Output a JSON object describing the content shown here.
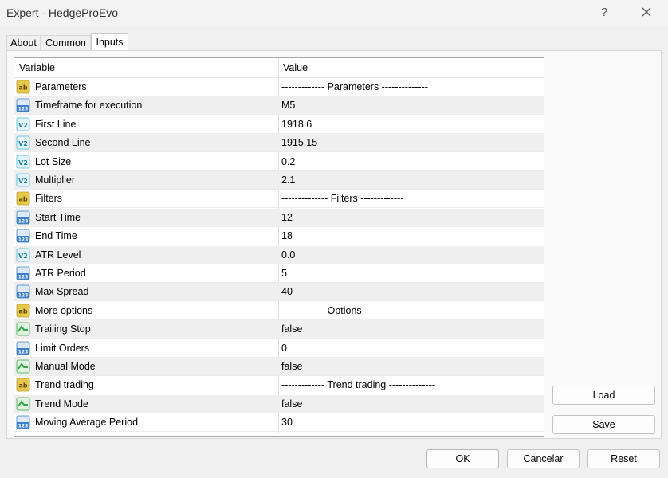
{
  "window": {
    "title": "Expert - HedgeProEvo",
    "help_glyph": "?"
  },
  "tabs": [
    {
      "label": "About"
    },
    {
      "label": "Common"
    },
    {
      "label": "Inputs",
      "active": true
    }
  ],
  "table": {
    "columns": {
      "variable": "Variable",
      "value": "Value"
    },
    "rows": [
      {
        "type": "string",
        "icon": "ab-string-icon",
        "name": "Parameters",
        "value": "------------- Parameters --------------"
      },
      {
        "type": "int",
        "icon": "123-integer-icon",
        "name": "Timeframe for execution",
        "value": "M5"
      },
      {
        "type": "double",
        "icon": "v2-double-icon",
        "name": "First Line",
        "value": "1918.6"
      },
      {
        "type": "double",
        "icon": "v2-double-icon",
        "name": "Second Line",
        "value": "1915.15"
      },
      {
        "type": "double",
        "icon": "v2-double-icon",
        "name": "Lot Size",
        "value": "0.2"
      },
      {
        "type": "double",
        "icon": "v2-double-icon",
        "name": "Multiplier",
        "value": "2.1"
      },
      {
        "type": "string",
        "icon": "ab-string-icon",
        "name": "Filters",
        "value": "-------------- Filters -------------"
      },
      {
        "type": "int",
        "icon": "123-integer-icon",
        "name": "Start Time",
        "value": "12"
      },
      {
        "type": "int",
        "icon": "123-integer-icon",
        "name": "End Time",
        "value": "18"
      },
      {
        "type": "double",
        "icon": "v2-double-icon",
        "name": "ATR Level",
        "value": "0.0"
      },
      {
        "type": "int",
        "icon": "123-integer-icon",
        "name": "ATR Period",
        "value": "5"
      },
      {
        "type": "int",
        "icon": "123-integer-icon",
        "name": "Max Spread",
        "value": "40"
      },
      {
        "type": "string",
        "icon": "ab-string-icon",
        "name": "More options",
        "value": "------------- Options --------------"
      },
      {
        "type": "bool",
        "icon": "bool-toggle-icon",
        "name": "Trailing Stop",
        "value": "false"
      },
      {
        "type": "int",
        "icon": "123-integer-icon",
        "name": "Limit Orders",
        "value": "0"
      },
      {
        "type": "bool",
        "icon": "bool-toggle-icon",
        "name": "Manual Mode",
        "value": "false"
      },
      {
        "type": "string",
        "icon": "ab-string-icon",
        "name": "Trend trading",
        "value": "------------- Trend trading --------------"
      },
      {
        "type": "bool",
        "icon": "bool-toggle-icon",
        "name": "Trend Mode",
        "value": "false"
      },
      {
        "type": "int",
        "icon": "123-integer-icon",
        "name": "Moving Average Period",
        "value": "30"
      }
    ]
  },
  "side_buttons": {
    "load": "Load",
    "save": "Save"
  },
  "footer_buttons": {
    "ok": "OK",
    "cancel": "Cancelar",
    "reset": "Reset"
  },
  "colors": {
    "string_icon": "#e8c84a",
    "int_icon": "#3d7fc9",
    "double_icon": "#4db6d6",
    "bool_icon": "#3aa64a"
  }
}
